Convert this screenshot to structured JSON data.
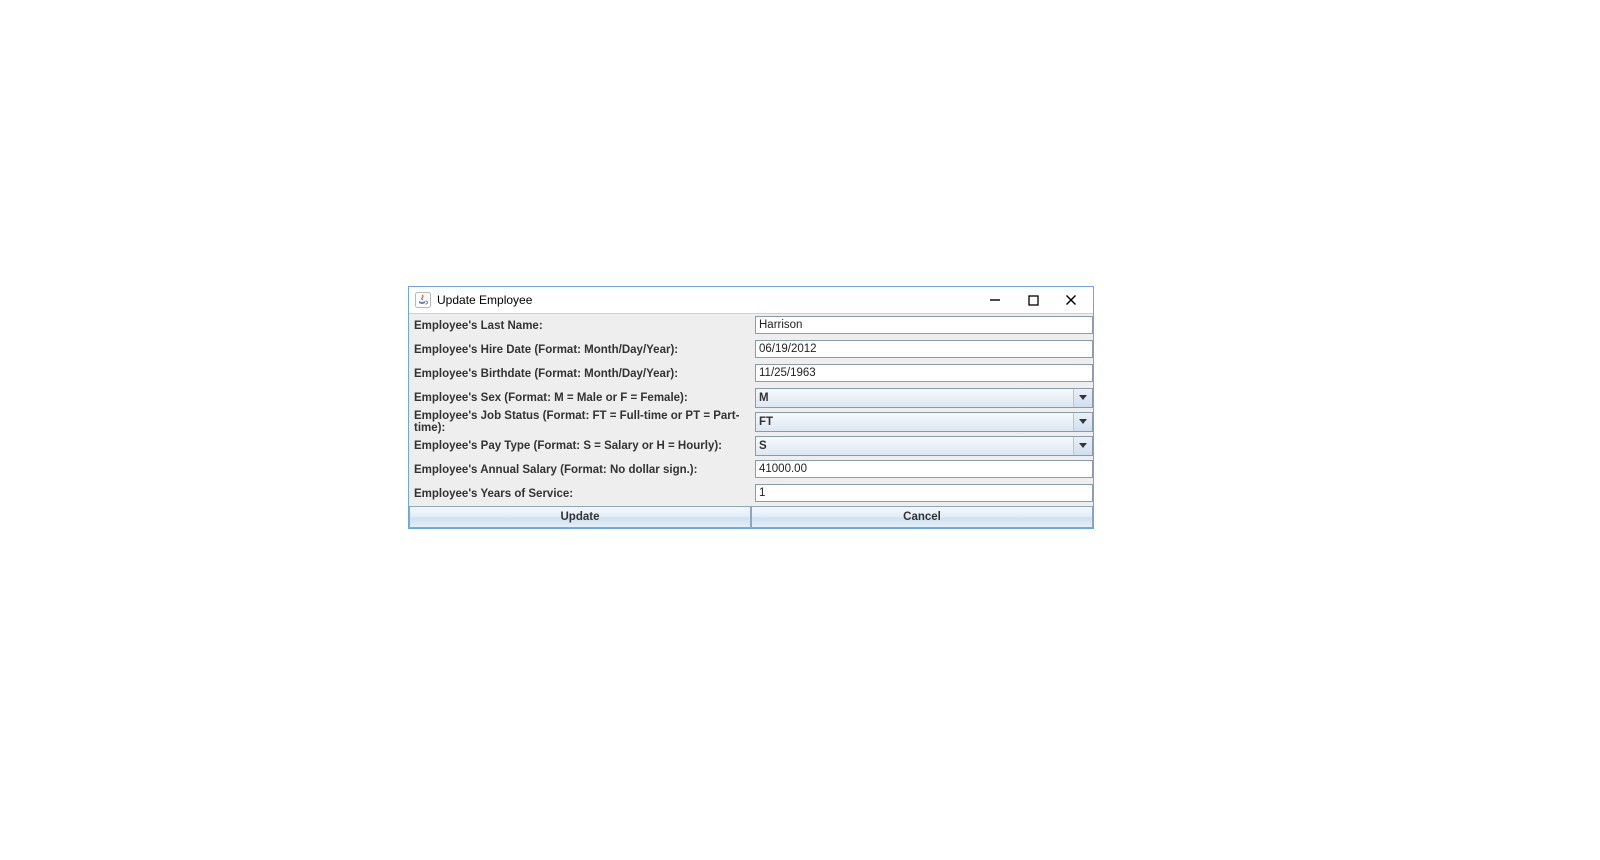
{
  "window": {
    "title": "Update Employee"
  },
  "labels": {
    "last_name": "Employee's Last Name:",
    "hire_date": "Employee's Hire Date (Format: Month/Day/Year):",
    "birthdate": "Employee's Birthdate (Format: Month/Day/Year):",
    "sex": "Employee's Sex (Format: M = Male or F = Female):",
    "job_status": "Employee's Job Status (Format: FT = Full-time or PT = Part-time):",
    "pay_type": "Employee's Pay Type (Format: S = Salary or H = Hourly):",
    "salary": "Employee's Annual Salary (Format: No dollar sign.):",
    "years": "Employee's Years of Service:"
  },
  "values": {
    "last_name": "Harrison",
    "hire_date": "06/19/2012",
    "birthdate": "11/25/1963",
    "sex": "M",
    "job_status": "FT",
    "pay_type": "S",
    "salary": "41000.00",
    "years": "1"
  },
  "buttons": {
    "update": "Update",
    "cancel": "Cancel"
  }
}
